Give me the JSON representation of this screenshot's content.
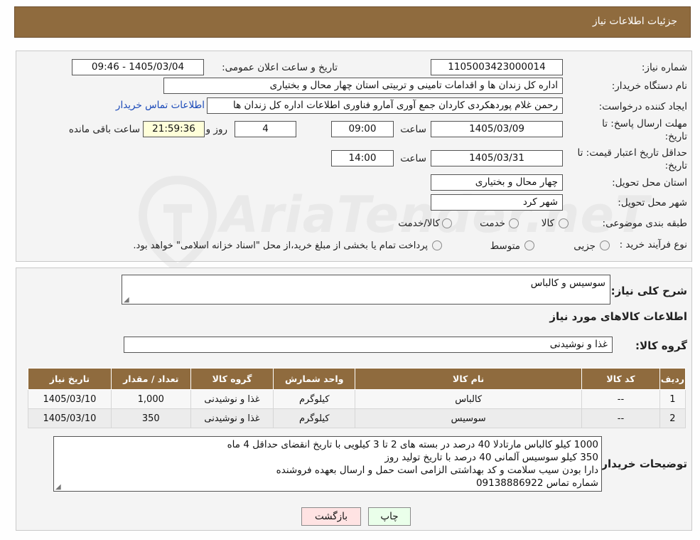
{
  "header": {
    "title": "جزئیات اطلاعات نیاز"
  },
  "form": {
    "need_number": {
      "label": "شماره نیاز:",
      "value": "1105003423000014"
    },
    "announce_datetime": {
      "label": "تاریخ و ساعت اعلان عمومی:",
      "value": "1405/03/04 - 09:46"
    },
    "buyer_org": {
      "label": "نام دستگاه خریدار:",
      "value": "اداره کل زندان ها و اقدامات تامینی و تربیتی استان چهار محال و بختیاری"
    },
    "requester": {
      "label": "ایجاد کننده درخواست:",
      "value": "رحمن غلام پوردهکردی کاردان جمع آوری آمارو فناوری اطلاعات اداره کل زندان ها",
      "contact_link": "اطلاعات تماس خریدار"
    },
    "reply_deadline": {
      "label_line1": "مهلت ارسال پاسخ: تا",
      "label_line2": "تاریخ:",
      "date": "1405/03/09",
      "time_label": "ساعت",
      "time": "09:00",
      "days": "4",
      "days_label": "روز و",
      "countdown": "21:59:36",
      "remaining_label": "ساعت باقی مانده"
    },
    "price_validity": {
      "label_line1": "حداقل تاریخ اعتبار قیمت: تا",
      "label_line2": "تاریخ:",
      "date": "1405/03/31",
      "time_label": "ساعت",
      "time": "14:00"
    },
    "delivery_province": {
      "label": "استان محل تحویل:",
      "value": "چهار محال و بختیاری"
    },
    "delivery_city": {
      "label": "شهر محل تحویل:",
      "value": "شهر کرد"
    },
    "category": {
      "label": "طبقه بندی موضوعی:",
      "options": [
        "کالا",
        "خدمت",
        "کالا/خدمت"
      ]
    },
    "process_type": {
      "label": "نوع فرآیند خرید :",
      "options": [
        "جزیی",
        "متوسط"
      ],
      "note": "پرداخت تمام یا بخشی از مبلغ خرید،از محل \"اسناد خزانه اسلامی\" خواهد بود."
    }
  },
  "summary": {
    "label": "شرح کلی نیاز:",
    "value": "سوسیس و کالباس"
  },
  "goods_section": {
    "title": "اطلاعات کالاهای مورد نیاز"
  },
  "goods_group": {
    "label": "گروه کالا:",
    "value": "غذا و نوشیدنی"
  },
  "table": {
    "headers": [
      "ردیف",
      "کد کالا",
      "نام کالا",
      "واحد شمارش",
      "گروه کالا",
      "تعداد / مقدار",
      "تاریخ نیاز"
    ],
    "rows": [
      [
        "1",
        "--",
        "کالباس",
        "کیلوگرم",
        "غذا و نوشیدنی",
        "1,000",
        "1405/03/10"
      ],
      [
        "2",
        "--",
        "سوسیس",
        "کیلوگرم",
        "غذا و نوشیدنی",
        "350",
        "1405/03/10"
      ]
    ]
  },
  "buyer_notes": {
    "label": "توضیحات خریدار:",
    "lines": [
      "1000 کیلو کالباس مارتادلا 40 درصد در بسته های 2 تا 3 کیلویی با تاریخ انقضای حداقل 4 ماه",
      "350 کیلو سوسیس آلمانی 40 درصد با تاریخ تولید روز",
      "دارا بودن سیب سلامت و کد بهداشتی الزامی است حمل و ارسال بعهده فروشنده",
      "شماره تماس 09138886922"
    ]
  },
  "buttons": {
    "print": "چاپ",
    "back": "بازگشت"
  },
  "watermark": {
    "text": "AriaTender.neT"
  }
}
